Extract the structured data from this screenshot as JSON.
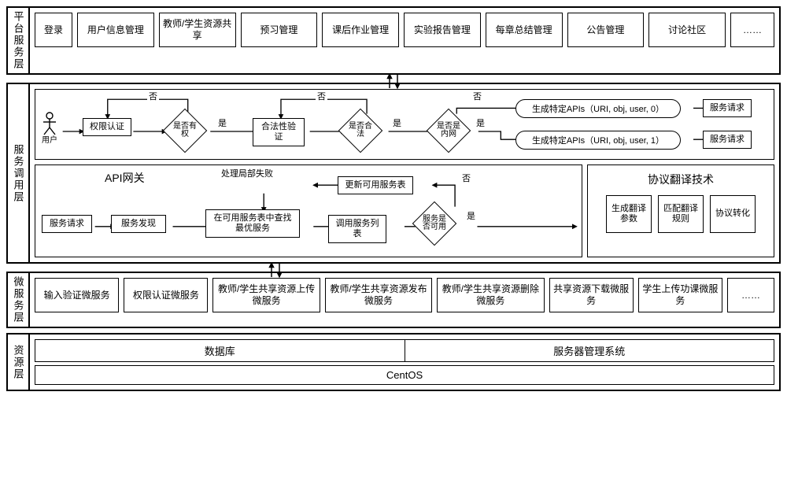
{
  "layers": {
    "platform": {
      "label": "平台服务层",
      "items": [
        "登录",
        "用户信息管理",
        "教师/学生资源共享",
        "预习管理",
        "课后作业管理",
        "实验报告管理",
        "每章总结管理",
        "公告管理",
        "讨论社区",
        "……"
      ]
    },
    "invoke": {
      "label": "服务调用层",
      "user": "用户",
      "flow": {
        "auth": "权限认证",
        "has_right": "是否有权",
        "validity": "合法性验证",
        "is_valid": "是否合法",
        "is_intranet": "是否是内网",
        "no": "否",
        "yes": "是",
        "api0": "生成特定APIs（URI, obj, user, 0）",
        "api1": "生成特定APIs（URI, obj, user, 1）",
        "service_request": "服务请求"
      },
      "gateway": {
        "title": "API网关",
        "service_request": "服务请求",
        "discovery": "服务发现",
        "partial_fail": "处理局部失败",
        "find_best": "在可用服务表中查找最优服务",
        "call_list": "调用服务列表",
        "update_table": "更新可用服务表",
        "available": "服务是否可用",
        "no": "否",
        "yes": "是"
      },
      "protocol": {
        "title": "协议翻译技术",
        "p1": "生成翻译参数",
        "p2": "匹配翻译规则",
        "p3": "协议转化"
      }
    },
    "micro": {
      "label": "微服务层",
      "items": [
        "输入验证微服务",
        "权限认证微服务",
        "教师/学生共享资源上传微服务",
        "教师/学生共享资源发布微服务",
        "教师/学生共享资源删除微服务",
        "共享资源下载微服务",
        "学生上传功课微服务",
        "……"
      ]
    },
    "resource": {
      "label": "资源层",
      "db": "数据库",
      "server_mgmt": "服务器管理系统",
      "os": "CentOS"
    }
  }
}
